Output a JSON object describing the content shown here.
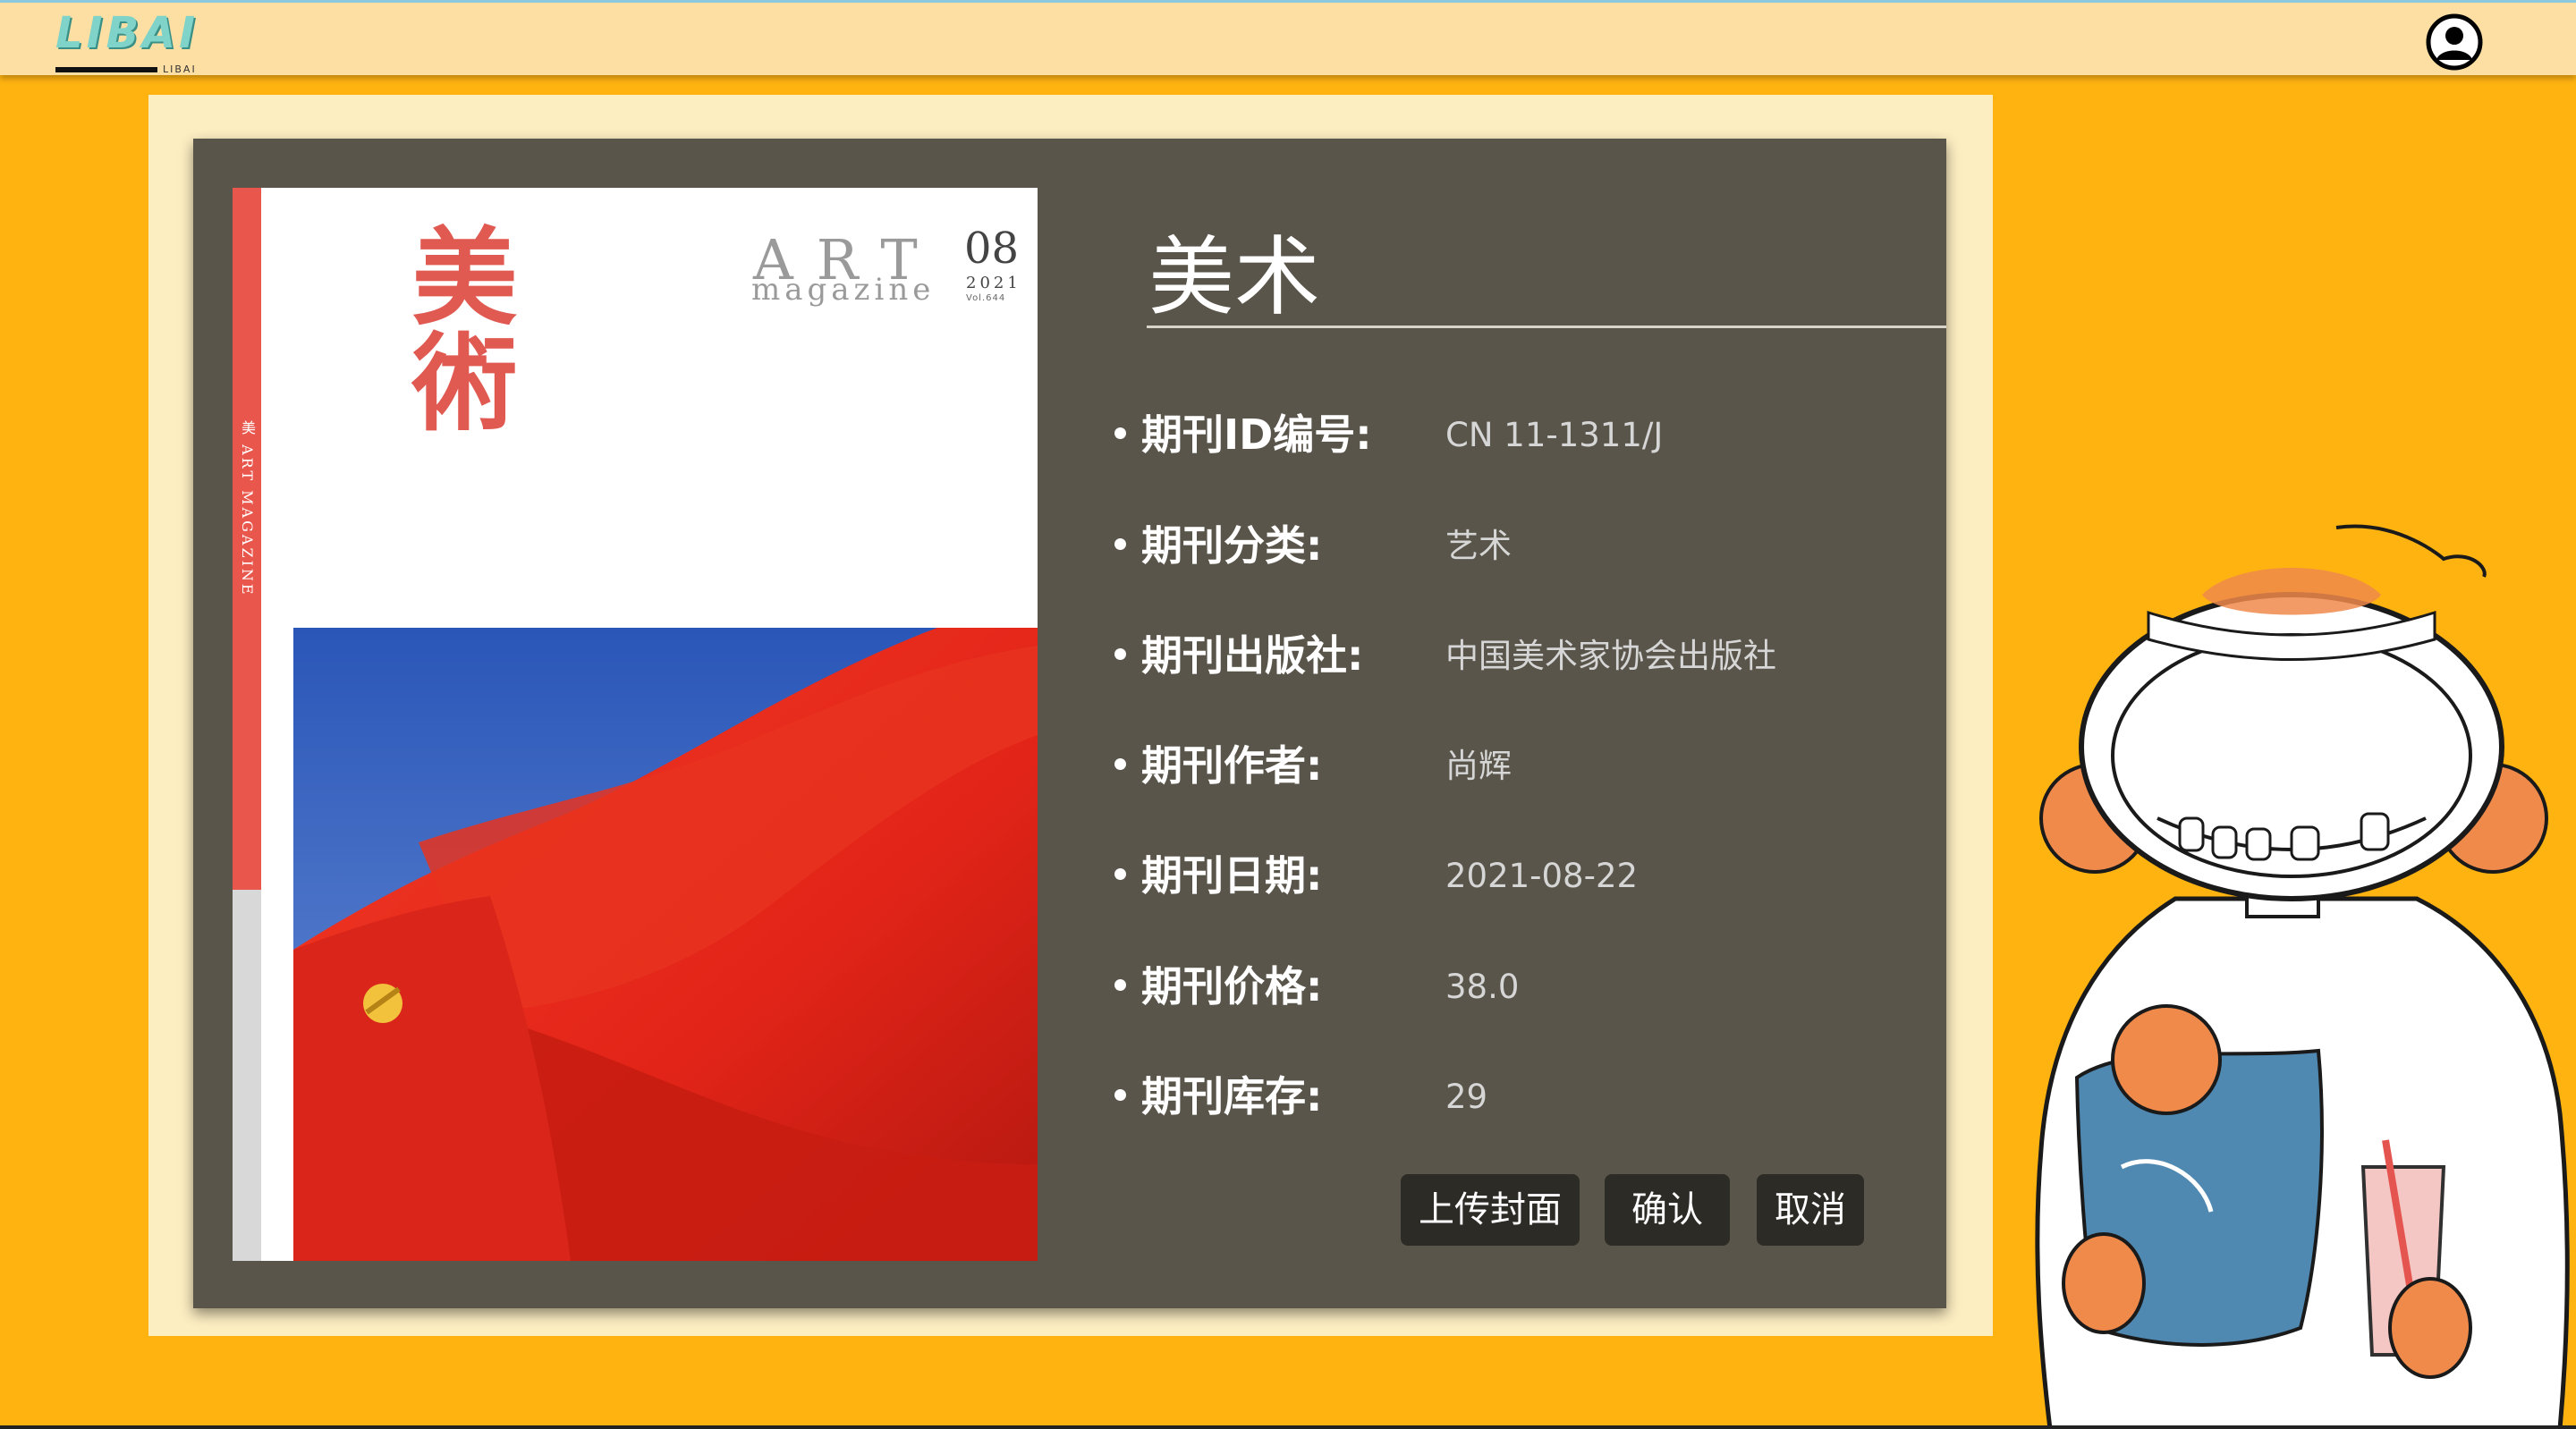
{
  "header": {
    "logo_text": "LIBAI",
    "logo_subtext": "LIBAI",
    "avatar_icon": "user-account-icon"
  },
  "cover": {
    "title_cn": "美術",
    "spine_title": "美",
    "spine_text": "ART MAGAZINE",
    "art_text": "ART",
    "magazine_text": "magazine",
    "issue_number": "08",
    "issue_year": "2021",
    "issue_vol": "Vol.644"
  },
  "magazine": {
    "title": "美术",
    "fields": [
      {
        "label": "期刊ID编号:",
        "value": "CN 11-1311/J"
      },
      {
        "label": "期刊分类:",
        "value": "艺术"
      },
      {
        "label": "期刊出版社:",
        "value": "中国美术家协会出版社"
      },
      {
        "label": "期刊作者:",
        "value": "尚辉"
      },
      {
        "label": "期刊日期:",
        "value": "2021-08-22"
      },
      {
        "label": "期刊价格:",
        "value": "38.0"
      },
      {
        "label": "期刊库存:",
        "value": "29"
      }
    ]
  },
  "actions": {
    "upload_cover": "上传封面",
    "confirm": "确认",
    "cancel": "取消"
  },
  "colors": {
    "page_background": "#ffb311",
    "topbar": "#fedfa3",
    "card": "#59554a",
    "button": "#2d2b26"
  }
}
